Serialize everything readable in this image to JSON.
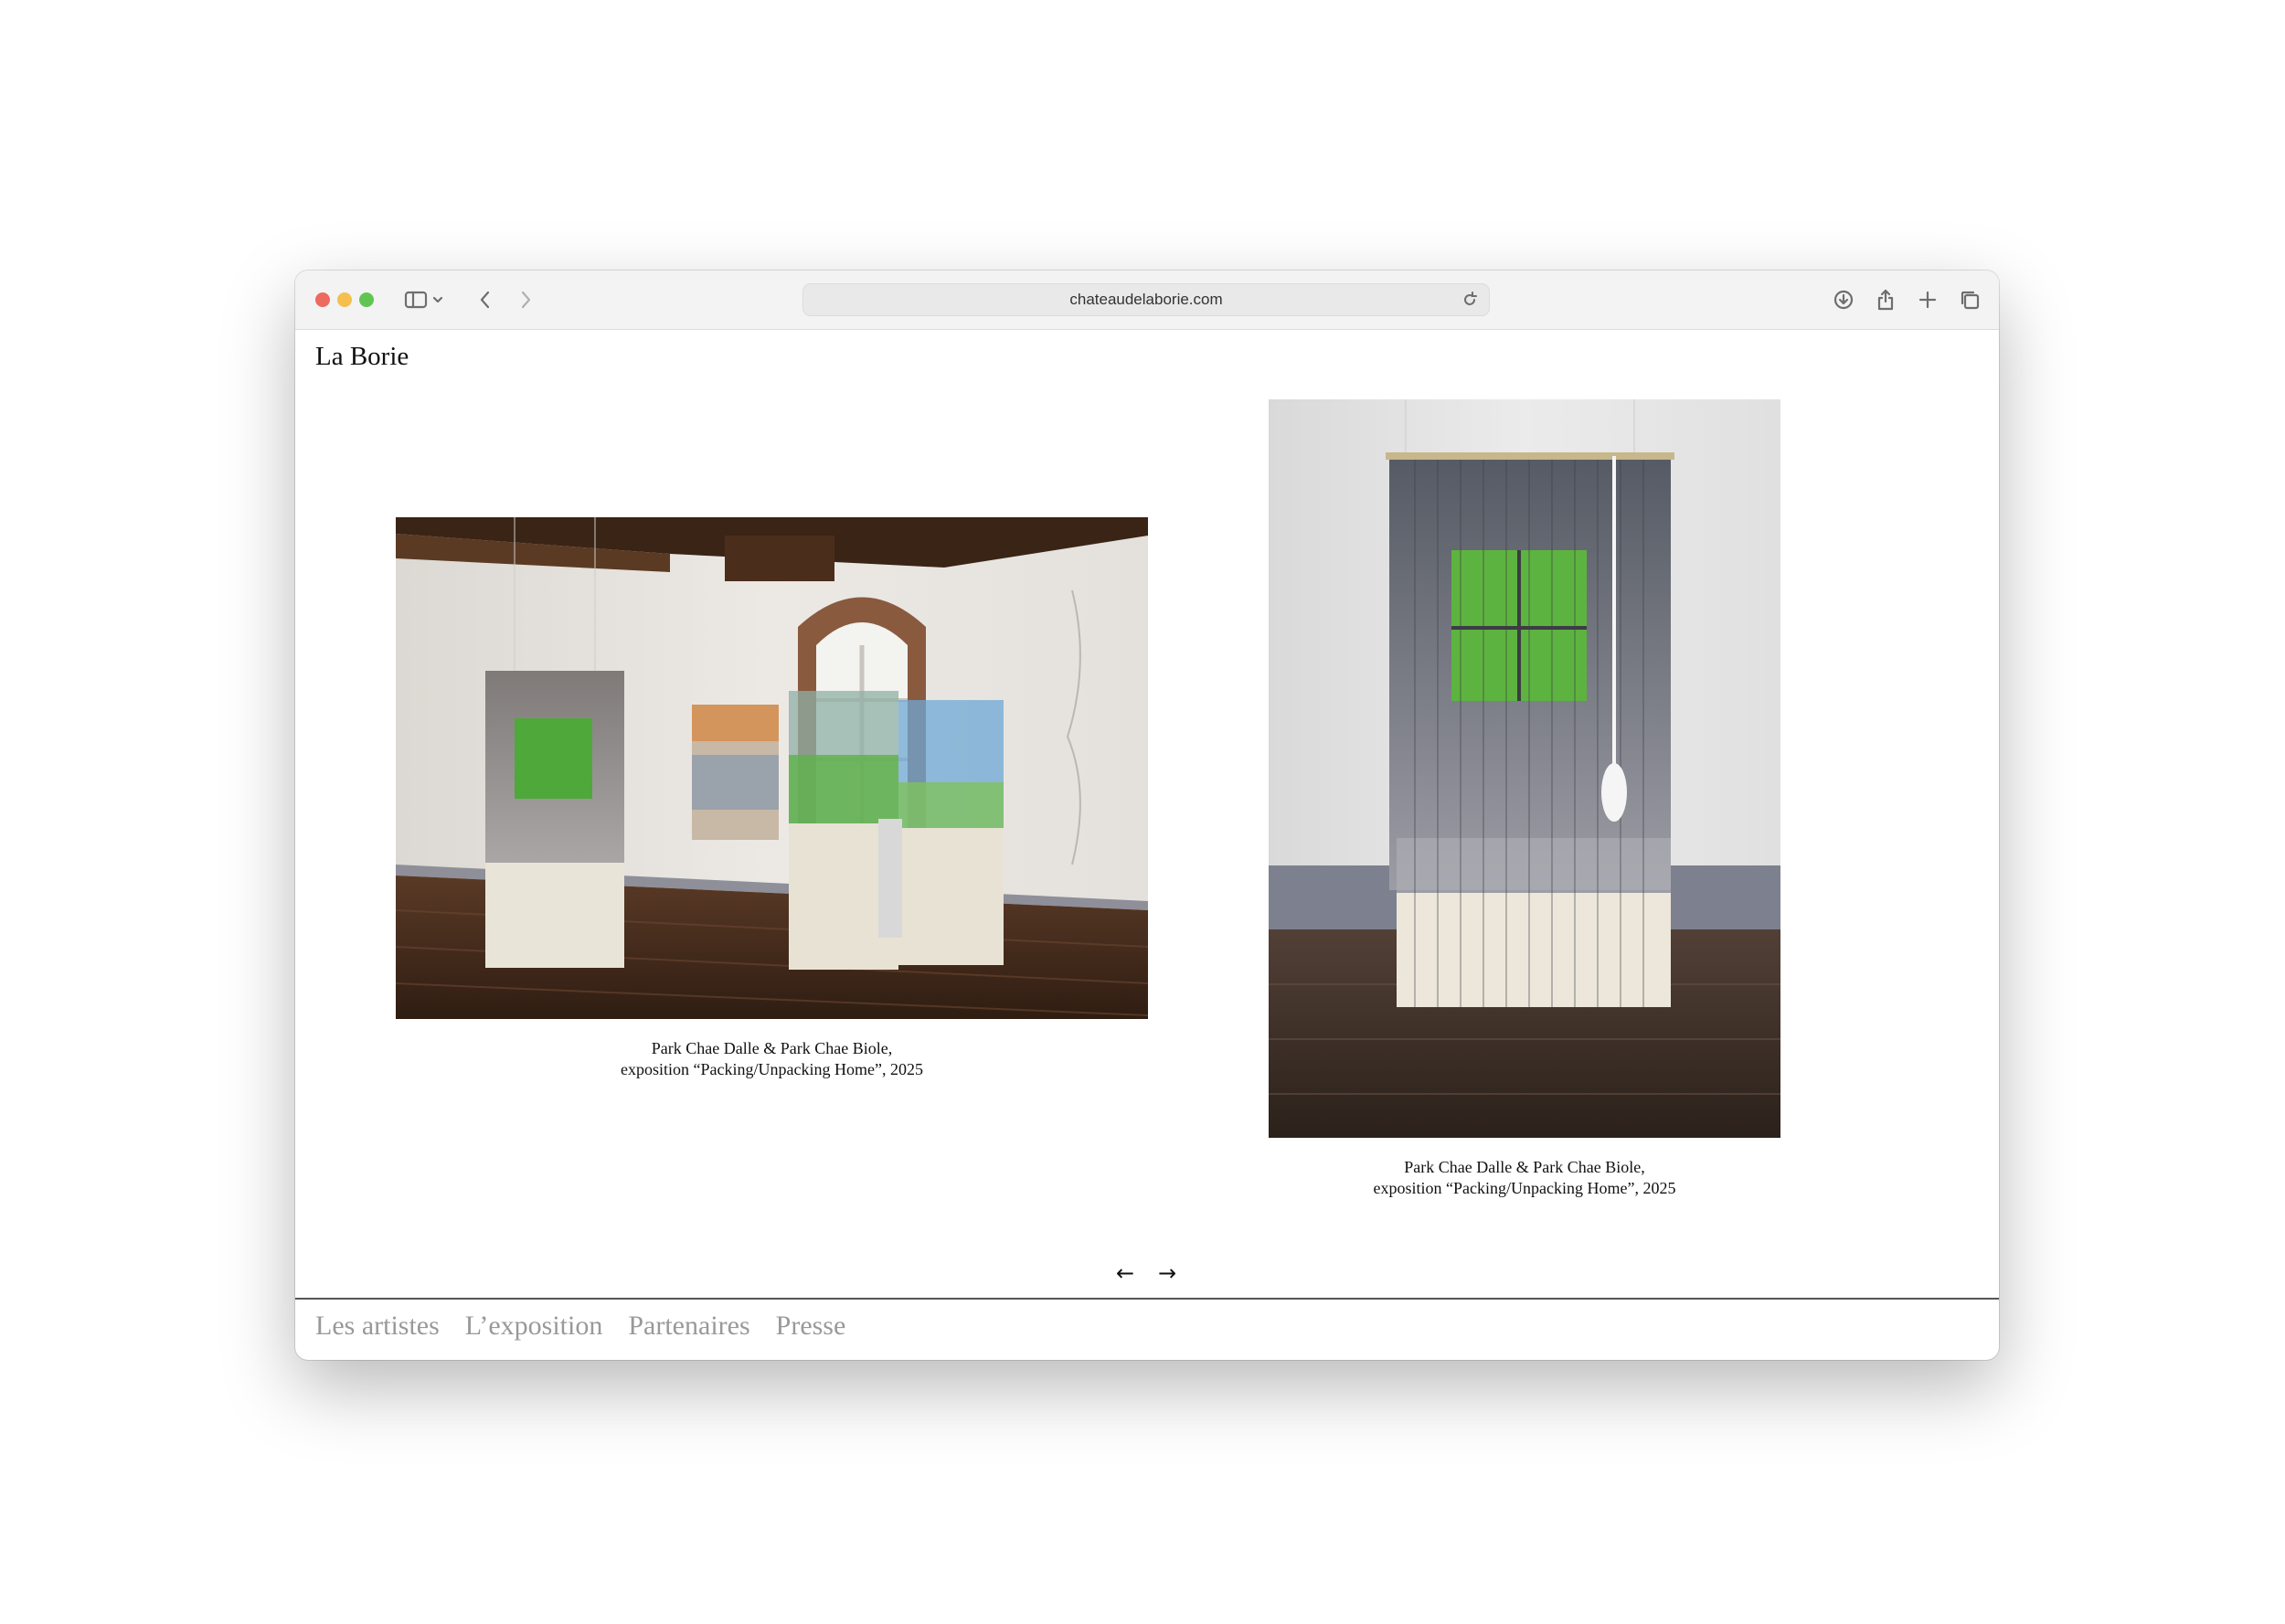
{
  "browser": {
    "url": "chateaudelaborie.com",
    "traffic_lights": {
      "close": "#ed6a5e",
      "minimize": "#f5bf4f",
      "maximize": "#61c554"
    }
  },
  "site": {
    "title": "La Borie"
  },
  "gallery": {
    "captions": [
      {
        "line1": "Park Chae Dalle & Park Chae Biole,",
        "line2": "exposition “Packing/Unpacking Home”, 2025"
      },
      {
        "line1": "Park Chae Dalle & Park Chae Biole,",
        "line2": "exposition “Packing/Unpacking Home”, 2025"
      }
    ],
    "prev_label": "←",
    "next_label": "→"
  },
  "nav": {
    "items": [
      {
        "label": "Les artistes"
      },
      {
        "label": "L’exposition"
      },
      {
        "label": "Partenaires"
      },
      {
        "label": "Presse"
      }
    ]
  }
}
